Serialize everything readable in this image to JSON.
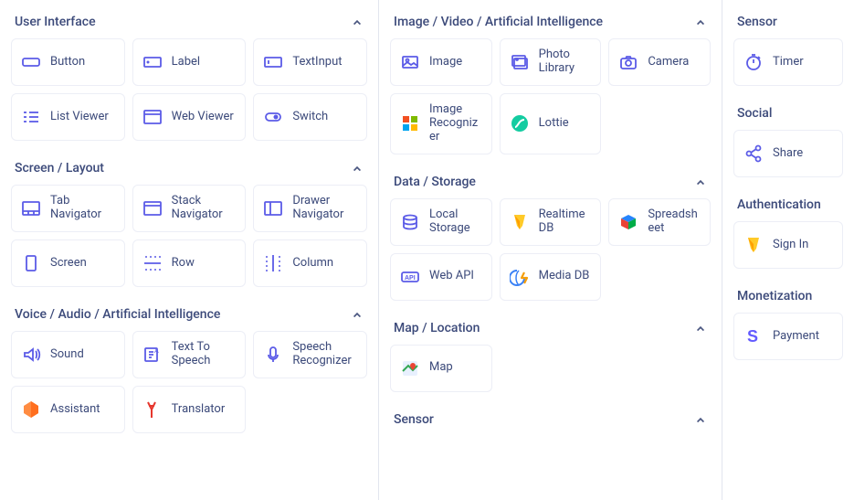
{
  "col1": {
    "sections": [
      {
        "title": "User Interface",
        "items": [
          {
            "label": "Button",
            "icon": "button-icon"
          },
          {
            "label": "Label",
            "icon": "label-icon"
          },
          {
            "label": "TextInput",
            "icon": "textinput-icon"
          },
          {
            "label": "List Viewer",
            "icon": "listviewer-icon"
          },
          {
            "label": "Web Viewer",
            "icon": "webviewer-icon"
          },
          {
            "label": "Switch",
            "icon": "switch-icon"
          }
        ]
      },
      {
        "title": "Screen / Layout",
        "items": [
          {
            "label": "Tab Navigator",
            "icon": "tabnav-icon"
          },
          {
            "label": "Stack Navigator",
            "icon": "stacknav-icon"
          },
          {
            "label": "Drawer Navigator",
            "icon": "drawernav-icon"
          },
          {
            "label": "Screen",
            "icon": "screen-icon"
          },
          {
            "label": "Row",
            "icon": "row-icon"
          },
          {
            "label": "Column",
            "icon": "column-icon"
          }
        ]
      },
      {
        "title": "Voice / Audio / Artificial Intelligence",
        "items": [
          {
            "label": "Sound",
            "icon": "sound-icon"
          },
          {
            "label": "Text To Speech",
            "icon": "tts-icon"
          },
          {
            "label": "Speech Recognizer",
            "icon": "speech-icon"
          },
          {
            "label": "Assistant",
            "icon": "assistant-icon"
          },
          {
            "label": "Translator",
            "icon": "translator-icon"
          }
        ]
      }
    ]
  },
  "col2": {
    "sections": [
      {
        "title": "Image / Video / Artificial Intelligence",
        "items": [
          {
            "label": "Image",
            "icon": "image-icon"
          },
          {
            "label": "Photo Library",
            "icon": "photolib-icon"
          },
          {
            "label": "Camera",
            "icon": "camera-icon"
          },
          {
            "label": "Image Recognizer",
            "icon": "image-rec-icon"
          },
          {
            "label": "Lottie",
            "icon": "lottie-icon"
          }
        ]
      },
      {
        "title": "Data / Storage",
        "items": [
          {
            "label": "Local Storage",
            "icon": "localstorage-icon"
          },
          {
            "label": "Realtime DB",
            "icon": "realtimedb-icon"
          },
          {
            "label": "Spreadsheet",
            "icon": "spreadsheet-icon"
          },
          {
            "label": "Web API",
            "icon": "webapi-icon"
          },
          {
            "label": "Media DB",
            "icon": "mediadb-icon"
          }
        ]
      },
      {
        "title": "Map / Location",
        "items": [
          {
            "label": "Map",
            "icon": "map-icon"
          }
        ]
      },
      {
        "title": "Sensor",
        "items": []
      }
    ]
  },
  "col3": {
    "sections": [
      {
        "title": "Sensor",
        "items": [
          {
            "label": "Timer",
            "icon": "timer-icon"
          }
        ]
      },
      {
        "title": "Social",
        "items": [
          {
            "label": "Share",
            "icon": "share-icon"
          }
        ]
      },
      {
        "title": "Authentication",
        "items": [
          {
            "label": "Sign In",
            "icon": "signin-icon"
          }
        ]
      },
      {
        "title": "Monetization",
        "items": [
          {
            "label": "Payment",
            "icon": "payment-icon"
          }
        ]
      }
    ]
  }
}
